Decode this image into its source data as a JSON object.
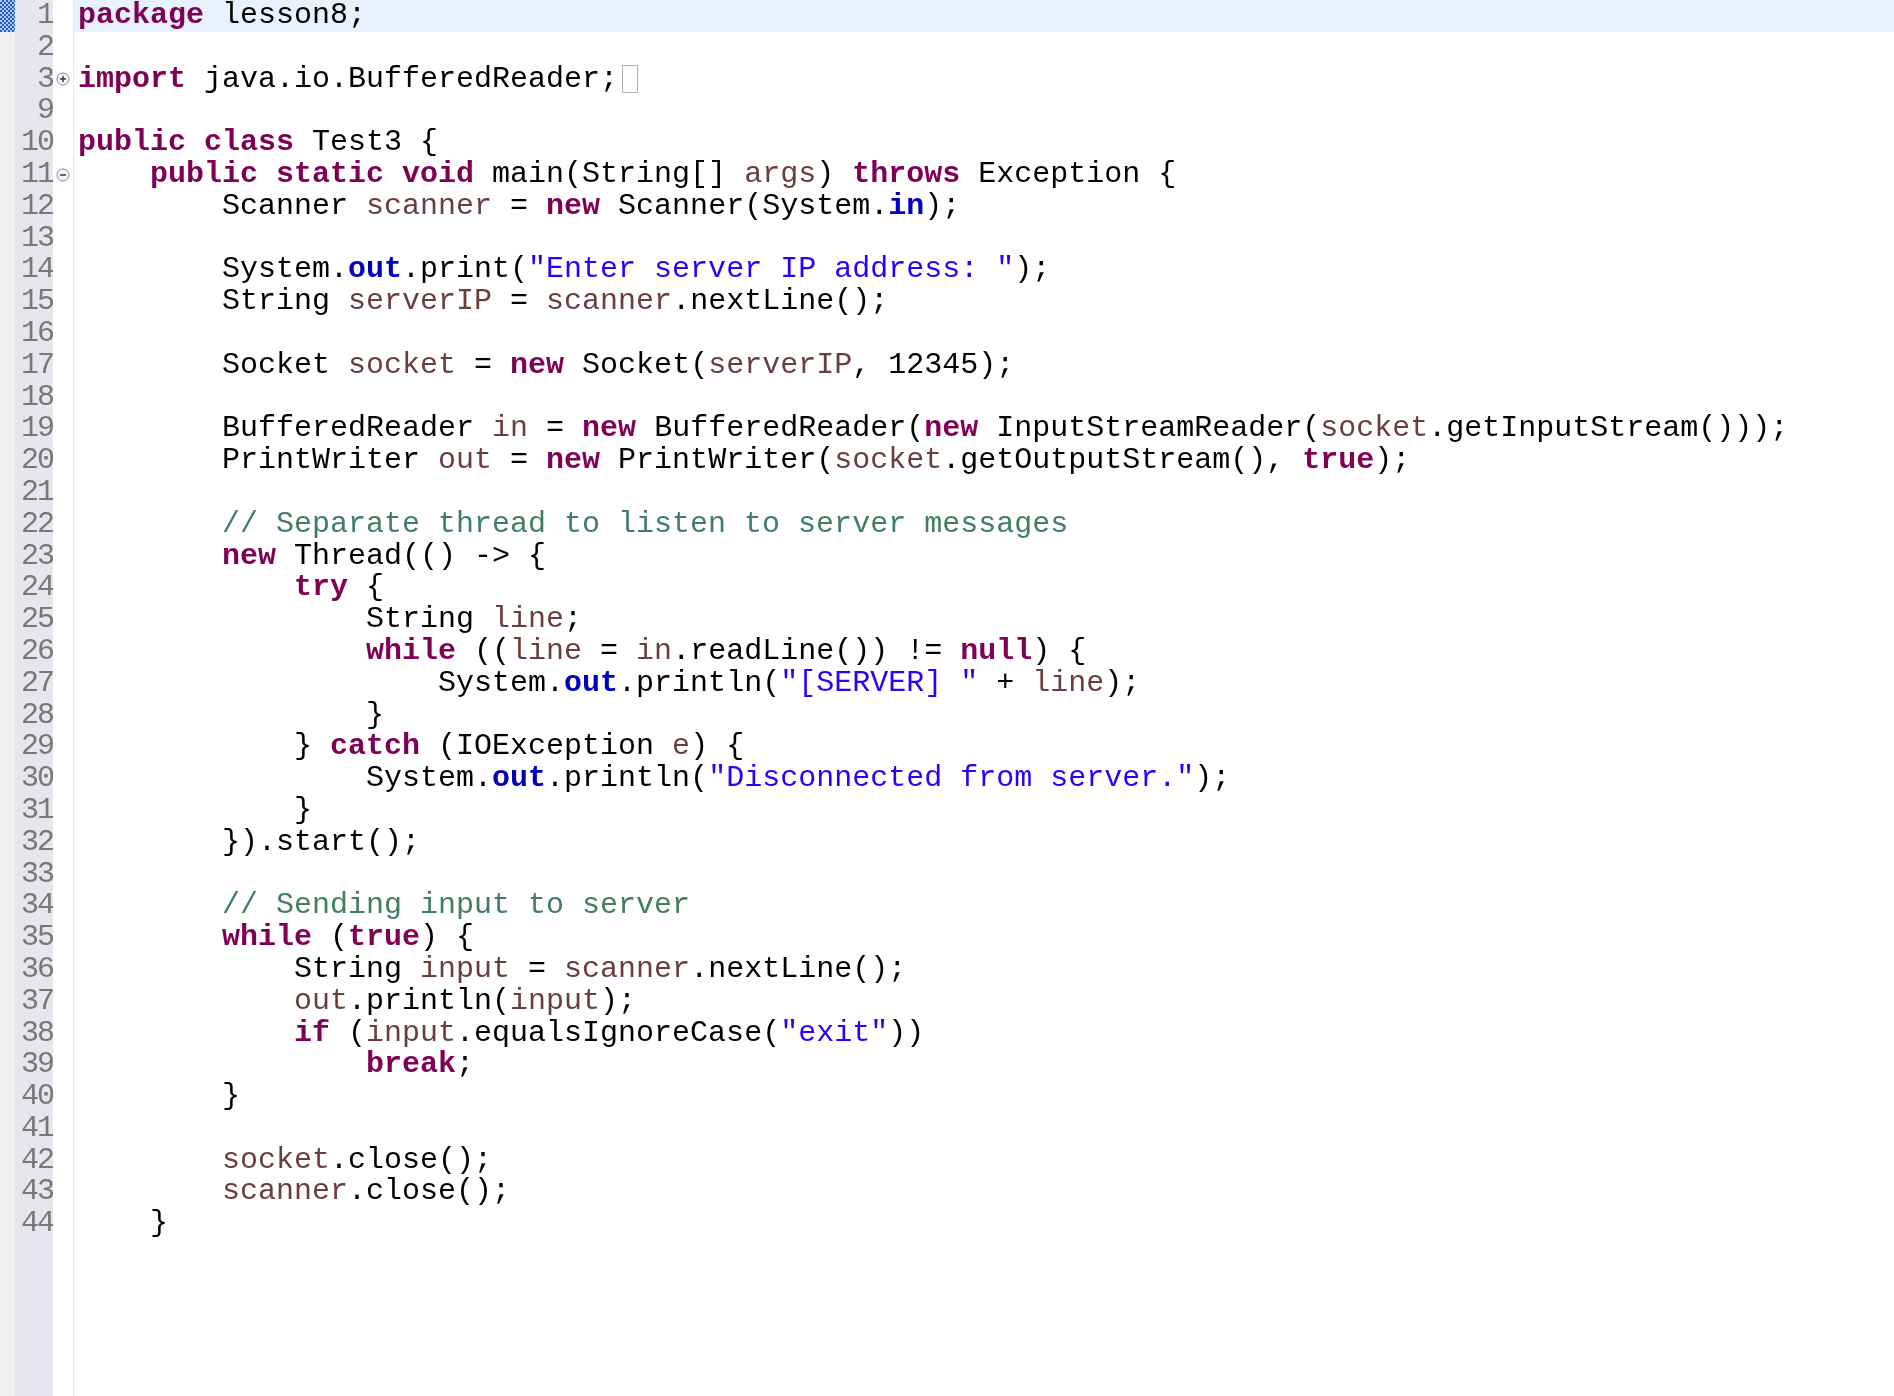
{
  "editor": {
    "lines": [
      {
        "number": "1",
        "current": true,
        "tokens": [
          {
            "kind": "keyword",
            "text": "package"
          },
          {
            "kind": "plain",
            "text": " lesson8;"
          }
        ]
      },
      {
        "number": "2",
        "current": false
      },
      {
        "number": "3",
        "current": false,
        "folded": true,
        "tokens": [
          {
            "kind": "keyword",
            "text": "import"
          },
          {
            "kind": "plain",
            "text": " java.io.BufferedReader;"
          }
        ]
      },
      {
        "number": "9",
        "current": false
      },
      {
        "number": "10",
        "current": false,
        "tokens": [
          {
            "kind": "keyword",
            "text": "public class"
          },
          {
            "kind": "plain",
            "text": " Test3 {"
          }
        ]
      },
      {
        "number": "11",
        "current": false,
        "folded": false,
        "tokens": [
          {
            "kind": "keyword",
            "text": "    public static void"
          },
          {
            "kind": "plain",
            "text": " main(String[] "
          },
          {
            "kind": "local",
            "text": "args"
          },
          {
            "kind": "plain",
            "text": ") "
          },
          {
            "kind": "keyword",
            "text": "throws"
          },
          {
            "kind": "plain",
            "text": " Exception {"
          }
        ]
      },
      {
        "number": "12",
        "current": false,
        "tokens": [
          {
            "kind": "plain",
            "text": "        Scanner "
          },
          {
            "kind": "local",
            "text": "scanner"
          },
          {
            "kind": "plain",
            "text": " = "
          },
          {
            "kind": "keyword",
            "text": "new"
          },
          {
            "kind": "plain",
            "text": " Scanner(System."
          },
          {
            "kind": "field",
            "text": "in"
          },
          {
            "kind": "plain",
            "text": ");"
          }
        ]
      },
      {
        "number": "13",
        "current": false
      },
      {
        "number": "14",
        "current": false,
        "tokens": [
          {
            "kind": "plain",
            "text": "        System."
          },
          {
            "kind": "field",
            "text": "out"
          },
          {
            "kind": "plain",
            "text": ".print("
          },
          {
            "kind": "string",
            "text": "\"Enter server IP address: \""
          },
          {
            "kind": "plain",
            "text": ");"
          }
        ]
      },
      {
        "number": "15",
        "current": false,
        "tokens": [
          {
            "kind": "plain",
            "text": "        String "
          },
          {
            "kind": "local",
            "text": "serverIP"
          },
          {
            "kind": "plain",
            "text": " = "
          },
          {
            "kind": "local",
            "text": "scanner"
          },
          {
            "kind": "plain",
            "text": ".nextLine();"
          }
        ]
      },
      {
        "number": "16",
        "current": false
      },
      {
        "number": "17",
        "current": false,
        "tokens": [
          {
            "kind": "plain",
            "text": "        Socket "
          },
          {
            "kind": "local",
            "text": "socket"
          },
          {
            "kind": "plain",
            "text": " = "
          },
          {
            "kind": "keyword",
            "text": "new"
          },
          {
            "kind": "plain",
            "text": " Socket("
          },
          {
            "kind": "local",
            "text": "serverIP"
          },
          {
            "kind": "plain",
            "text": ", 12345);"
          }
        ]
      },
      {
        "number": "18",
        "current": false
      },
      {
        "number": "19",
        "current": false,
        "tokens": [
          {
            "kind": "plain",
            "text": "        BufferedReader "
          },
          {
            "kind": "local",
            "text": "in"
          },
          {
            "kind": "plain",
            "text": " = "
          },
          {
            "kind": "keyword",
            "text": "new"
          },
          {
            "kind": "plain",
            "text": " BufferedReader("
          },
          {
            "kind": "keyword",
            "text": "new"
          },
          {
            "kind": "plain",
            "text": " InputStreamReader("
          },
          {
            "kind": "local",
            "text": "socket"
          },
          {
            "kind": "plain",
            "text": ".getInputStream()));"
          }
        ]
      },
      {
        "number": "20",
        "current": false,
        "tokens": [
          {
            "kind": "plain",
            "text": "        PrintWriter "
          },
          {
            "kind": "local",
            "text": "out"
          },
          {
            "kind": "plain",
            "text": " = "
          },
          {
            "kind": "keyword",
            "text": "new"
          },
          {
            "kind": "plain",
            "text": " PrintWriter("
          },
          {
            "kind": "local",
            "text": "socket"
          },
          {
            "kind": "plain",
            "text": ".getOutputStream(), "
          },
          {
            "kind": "keyword",
            "text": "true"
          },
          {
            "kind": "plain",
            "text": ");"
          }
        ]
      },
      {
        "number": "21",
        "current": false
      },
      {
        "number": "22",
        "current": false,
        "tokens": [
          {
            "kind": "comment",
            "text": "        // Separate thread to listen to server messages"
          }
        ]
      },
      {
        "number": "23",
        "current": false,
        "tokens": [
          {
            "kind": "keyword",
            "text": "        new"
          },
          {
            "kind": "plain",
            "text": " Thread(() -> {"
          }
        ]
      },
      {
        "number": "24",
        "current": false,
        "tokens": [
          {
            "kind": "keyword",
            "text": "            try"
          },
          {
            "kind": "plain",
            "text": " {"
          }
        ]
      },
      {
        "number": "25",
        "current": false,
        "tokens": [
          {
            "kind": "plain",
            "text": "                String "
          },
          {
            "kind": "local",
            "text": "line"
          },
          {
            "kind": "plain",
            "text": ";"
          }
        ]
      },
      {
        "number": "26",
        "current": false,
        "tokens": [
          {
            "kind": "keyword",
            "text": "                while"
          },
          {
            "kind": "plain",
            "text": " (("
          },
          {
            "kind": "local",
            "text": "line"
          },
          {
            "kind": "plain",
            "text": " = "
          },
          {
            "kind": "local",
            "text": "in"
          },
          {
            "kind": "plain",
            "text": ".readLine()) != "
          },
          {
            "kind": "keyword",
            "text": "null"
          },
          {
            "kind": "plain",
            "text": ") {"
          }
        ]
      },
      {
        "number": "27",
        "current": false,
        "tokens": [
          {
            "kind": "plain",
            "text": "                    System."
          },
          {
            "kind": "field",
            "text": "out"
          },
          {
            "kind": "plain",
            "text": ".println("
          },
          {
            "kind": "string",
            "text": "\"[SERVER] \""
          },
          {
            "kind": "plain",
            "text": " + "
          },
          {
            "kind": "local",
            "text": "line"
          },
          {
            "kind": "plain",
            "text": ");"
          }
        ]
      },
      {
        "number": "28",
        "current": false,
        "tokens": [
          {
            "kind": "plain",
            "text": "                }"
          }
        ]
      },
      {
        "number": "29",
        "current": false,
        "tokens": [
          {
            "kind": "plain",
            "text": "            } "
          },
          {
            "kind": "keyword",
            "text": "catch"
          },
          {
            "kind": "plain",
            "text": " (IOException "
          },
          {
            "kind": "local",
            "text": "e"
          },
          {
            "kind": "plain",
            "text": ") {"
          }
        ]
      },
      {
        "number": "30",
        "current": false,
        "tokens": [
          {
            "kind": "plain",
            "text": "                System."
          },
          {
            "kind": "field",
            "text": "out"
          },
          {
            "kind": "plain",
            "text": ".println("
          },
          {
            "kind": "string",
            "text": "\"Disconnected from server.\""
          },
          {
            "kind": "plain",
            "text": ");"
          }
        ]
      },
      {
        "number": "31",
        "current": false,
        "tokens": [
          {
            "kind": "plain",
            "text": "            }"
          }
        ]
      },
      {
        "number": "32",
        "current": false,
        "tokens": [
          {
            "kind": "plain",
            "text": "        }).start();"
          }
        ]
      },
      {
        "number": "33",
        "current": false
      },
      {
        "number": "34",
        "current": false,
        "tokens": [
          {
            "kind": "comment",
            "text": "        // Sending input to server"
          }
        ]
      },
      {
        "number": "35",
        "current": false,
        "tokens": [
          {
            "kind": "keyword",
            "text": "        while"
          },
          {
            "kind": "plain",
            "text": " ("
          },
          {
            "kind": "keyword",
            "text": "true"
          },
          {
            "kind": "plain",
            "text": ") {"
          }
        ]
      },
      {
        "number": "36",
        "current": false,
        "tokens": [
          {
            "kind": "plain",
            "text": "            String "
          },
          {
            "kind": "local",
            "text": "input"
          },
          {
            "kind": "plain",
            "text": " = "
          },
          {
            "kind": "local",
            "text": "scanner"
          },
          {
            "kind": "plain",
            "text": ".nextLine();"
          }
        ]
      },
      {
        "number": "37",
        "current": false,
        "tokens": [
          {
            "kind": "local",
            "text": "            out"
          },
          {
            "kind": "plain",
            "text": ".println("
          },
          {
            "kind": "local",
            "text": "input"
          },
          {
            "kind": "plain",
            "text": ");"
          }
        ]
      },
      {
        "number": "38",
        "current": false,
        "tokens": [
          {
            "kind": "keyword",
            "text": "            if"
          },
          {
            "kind": "plain",
            "text": " ("
          },
          {
            "kind": "local",
            "text": "input"
          },
          {
            "kind": "plain",
            "text": ".equalsIgnoreCase("
          },
          {
            "kind": "string",
            "text": "\"exit\""
          },
          {
            "kind": "plain",
            "text": "))"
          }
        ]
      },
      {
        "number": "39",
        "current": false,
        "tokens": [
          {
            "kind": "keyword",
            "text": "                break"
          },
          {
            "kind": "plain",
            "text": ";"
          }
        ]
      },
      {
        "number": "40",
        "current": false,
        "tokens": [
          {
            "kind": "plain",
            "text": "        }"
          }
        ]
      },
      {
        "number": "41",
        "current": false
      },
      {
        "number": "42",
        "current": false,
        "tokens": [
          {
            "kind": "local",
            "text": "        socket"
          },
          {
            "kind": "plain",
            "text": ".close();"
          }
        ]
      },
      {
        "number": "43",
        "current": false,
        "tokens": [
          {
            "kind": "local",
            "text": "        scanner"
          },
          {
            "kind": "plain",
            "text": ".close();"
          }
        ]
      },
      {
        "number": "44",
        "current": false,
        "tokens": [
          {
            "kind": "plain",
            "text": "    }"
          }
        ]
      }
    ]
  }
}
